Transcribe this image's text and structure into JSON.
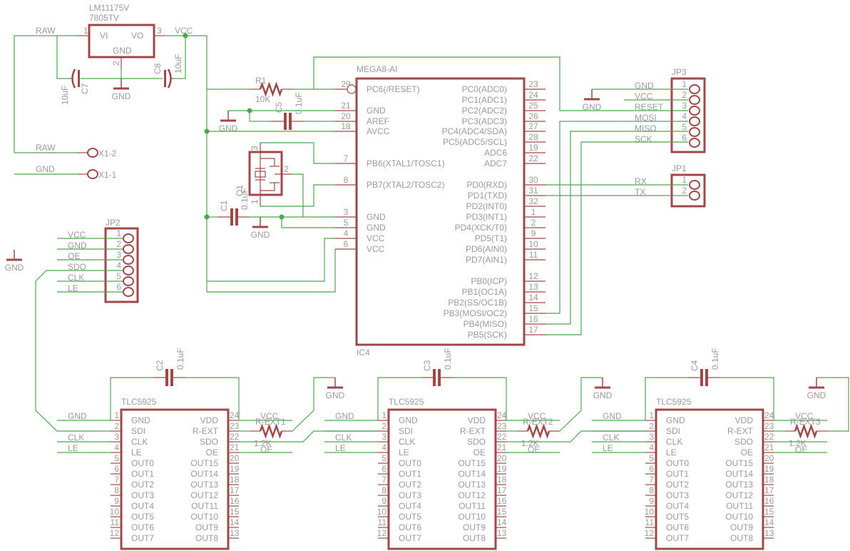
{
  "colors": {
    "wire": "#4ca64c",
    "part": "#a04848",
    "text": "#9a9a9a",
    "background": "#ffffff"
  },
  "net_labels": {
    "raw": "RAW",
    "vcc": "VCC",
    "gnd": "GND"
  },
  "regulator": {
    "name": "LM11175V",
    "value": "7805TV",
    "vi": "VI",
    "vo": "VO",
    "gnd": "GND",
    "pin_vi": "1",
    "pin_gnd": "2",
    "pin_vo": "3"
  },
  "c7": {
    "name": "C7",
    "value": "10uF"
  },
  "c8": {
    "name": "C8",
    "value": "10uF"
  },
  "c5": {
    "name": "C5",
    "value": "0.1uF"
  },
  "c1": {
    "name": "C1",
    "value": "0.1uF"
  },
  "r1": {
    "name": "R1",
    "value": "10K"
  },
  "q1": {
    "name": "Q1",
    "pin_numbers": [
      "1",
      "2",
      "3"
    ]
  },
  "x1": {
    "pad2": "X1-2",
    "pad1": "X1-1"
  },
  "ic4": {
    "name": "IC4",
    "value": "MEGA8-AI",
    "left_pins": [
      {
        "num": "29",
        "label": "PC6(/RESET)"
      },
      {
        "num": "21",
        "label": "GND"
      },
      {
        "num": "20",
        "label": "AREF"
      },
      {
        "num": "18",
        "label": "AVCC"
      },
      {
        "num": "7",
        "label": "PB6(XTAL1/TOSC1)"
      },
      {
        "num": "8",
        "label": "PB7(XTAL2/TOSC2)"
      },
      {
        "num": "3",
        "label": "GND"
      },
      {
        "num": "5",
        "label": "GND"
      },
      {
        "num": "4",
        "label": "VCC"
      },
      {
        "num": "6",
        "label": "VCC"
      }
    ],
    "right_pins": [
      {
        "num": "23",
        "label": "PC0(ADC0)"
      },
      {
        "num": "24",
        "label": "PC1(ADC1)"
      },
      {
        "num": "25",
        "label": "PC2(ADC2)"
      },
      {
        "num": "26",
        "label": "PC3(ADC3)"
      },
      {
        "num": "27",
        "label": "PC4(ADC4/SDA)"
      },
      {
        "num": "28",
        "label": "PC5(ADC5/SCL)"
      },
      {
        "num": "19",
        "label": "ADC6"
      },
      {
        "num": "22",
        "label": "ADC7"
      },
      {
        "num": "30",
        "label": "PD0(RXD)"
      },
      {
        "num": "31",
        "label": "PD1(TXD)"
      },
      {
        "num": "32",
        "label": "PD2(INT0)"
      },
      {
        "num": "1",
        "label": "PD3(INT1)"
      },
      {
        "num": "2",
        "label": "PD4(XCK/T0)"
      },
      {
        "num": "9",
        "label": "PD5(T1)"
      },
      {
        "num": "10",
        "label": "PD6(AIN0)"
      },
      {
        "num": "11",
        "label": "PD7(AIN1)"
      },
      {
        "num": "12",
        "label": "PB0(ICP)"
      },
      {
        "num": "13",
        "label": "PB1(OC1A)"
      },
      {
        "num": "14",
        "label": "PB2(SS/OC1B)"
      },
      {
        "num": "15",
        "label": "PB3(MOSI/OC2)"
      },
      {
        "num": "16",
        "label": "PB4(MISO)"
      },
      {
        "num": "17",
        "label": "PB5(SCK)"
      }
    ]
  },
  "jp3": {
    "name": "JP3",
    "pins": [
      {
        "num": "1",
        "net": "GND"
      },
      {
        "num": "2",
        "net": "VCC"
      },
      {
        "num": "3",
        "net": "RESET"
      },
      {
        "num": "4",
        "net": "MOSI"
      },
      {
        "num": "5",
        "net": "MISO"
      },
      {
        "num": "6",
        "net": "SCK"
      }
    ]
  },
  "jp1": {
    "name": "JP1",
    "pins": [
      {
        "num": "1",
        "net": "RX"
      },
      {
        "num": "2",
        "net": "TX"
      }
    ]
  },
  "jp2": {
    "name": "JP2",
    "pins": [
      {
        "num": "1",
        "net": "VCC"
      },
      {
        "num": "2",
        "net": "GND"
      },
      {
        "num": "3",
        "net": "OE"
      },
      {
        "num": "4",
        "net": "SDO"
      },
      {
        "num": "5",
        "net": "CLK"
      },
      {
        "num": "6",
        "net": "LE"
      }
    ]
  },
  "tlc_pins": {
    "left": [
      {
        "num": "1",
        "label": "GND"
      },
      {
        "num": "2",
        "label": "SDI"
      },
      {
        "num": "3",
        "label": "CLK"
      },
      {
        "num": "4",
        "label": "LE"
      },
      {
        "num": "5",
        "label": "OUT0"
      },
      {
        "num": "6",
        "label": "OUT1"
      },
      {
        "num": "7",
        "label": "OUT2"
      },
      {
        "num": "8",
        "label": "OUT3"
      },
      {
        "num": "9",
        "label": "OUT4"
      },
      {
        "num": "10",
        "label": "OUT5"
      },
      {
        "num": "11",
        "label": "OUT6"
      },
      {
        "num": "12",
        "label": "OUT7"
      }
    ],
    "right": [
      {
        "num": "24",
        "label": "VDD"
      },
      {
        "num": "23",
        "label": "R-EXT"
      },
      {
        "num": "22",
        "label": "SDO"
      },
      {
        "num": "21",
        "label": "OE"
      },
      {
        "num": "20",
        "label": "OUT15"
      },
      {
        "num": "19",
        "label": "OUT14"
      },
      {
        "num": "18",
        "label": "OUT13"
      },
      {
        "num": "17",
        "label": "OUT12"
      },
      {
        "num": "16",
        "label": "OUT11"
      },
      {
        "num": "15",
        "label": "OUT10"
      },
      {
        "num": "14",
        "label": "OUT9"
      },
      {
        "num": "13",
        "label": "OUT8"
      }
    ]
  },
  "drivers": [
    {
      "name": "TLC5925",
      "cap": {
        "name": "C2",
        "value": "0.1uF"
      },
      "resistor": {
        "name": "R-EXT1",
        "value": "1.2K"
      },
      "labels": {
        "gnd": "GND",
        "clk": "CLK",
        "le": "LE",
        "vcc": "VCC",
        "oe": "OE",
        "gnd_symbol": "GND"
      }
    },
    {
      "name": "TLC5925",
      "cap": {
        "name": "C3",
        "value": "0.1uF"
      },
      "resistor": {
        "name": "R-EXT2",
        "value": "1.2K"
      },
      "labels": {
        "gnd": "GND",
        "clk": "CLK",
        "le": "LE",
        "vcc": "VCC",
        "oe": "OE",
        "gnd_symbol": "GND"
      }
    },
    {
      "name": "TLC5925",
      "cap": {
        "name": "C4",
        "value": "0.1uF"
      },
      "resistor": {
        "name": "R-EXT3",
        "value": "1.2K"
      },
      "labels": {
        "gnd": "GND",
        "clk": "CLK",
        "le": "LE",
        "vcc": "VCC",
        "oe": "OE",
        "gnd_symbol": "GND"
      }
    }
  ]
}
